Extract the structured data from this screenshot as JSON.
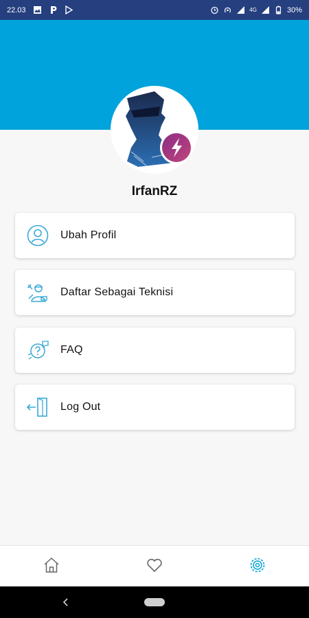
{
  "status_bar": {
    "time": "22.03",
    "network": "4G",
    "battery": "30%",
    "left_icons": [
      "image-icon",
      "p-app-icon",
      "play-store-icon"
    ],
    "right_icons": [
      "alarm-icon",
      "hotspot-icon",
      "signal-icon",
      "signal-4g-icon",
      "battery-icon"
    ]
  },
  "profile": {
    "username": "IrfanRZ",
    "header_color": "#00a3db",
    "avatar_badge_color": "#a03a79"
  },
  "menu": {
    "items": [
      {
        "label": "Ubah Profil",
        "icon": "user-icon"
      },
      {
        "label": "Daftar Sebagai Teknisi",
        "icon": "technician-icon"
      },
      {
        "label": "FAQ",
        "icon": "faq-icon"
      },
      {
        "label": "Log Out",
        "icon": "logout-icon"
      }
    ],
    "icon_color": "#3aa9d6"
  },
  "bottom_nav": {
    "items": [
      {
        "name": "home",
        "icon": "home-icon",
        "active": false
      },
      {
        "name": "favorites",
        "icon": "heart-icon",
        "active": false
      },
      {
        "name": "settings",
        "icon": "gear-icon",
        "active": true
      }
    ],
    "active_color": "#00a3db",
    "inactive_color": "#666666"
  }
}
